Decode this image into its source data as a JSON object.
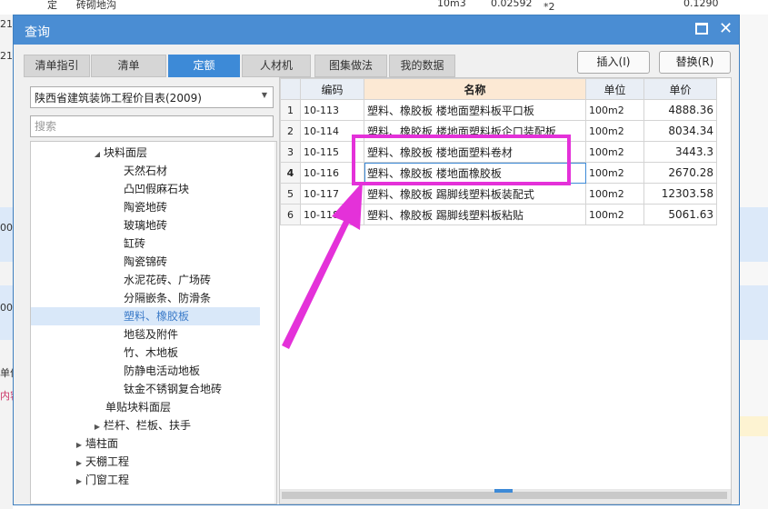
{
  "background": {
    "top_cells": [
      "定",
      "砖砌地沟",
      "10m3",
      "0.02592",
      "*2",
      "0.1290"
    ],
    "left_fragments": [
      "21",
      "21",
      "00",
      "00",
      "单价",
      "内容"
    ]
  },
  "dialog": {
    "title": "查询",
    "tabs": [
      {
        "label": "清单指引"
      },
      {
        "label": "清单"
      },
      {
        "label": "定额"
      },
      {
        "label": "人材机"
      },
      {
        "label": "图集做法"
      },
      {
        "label": "我的数据"
      }
    ],
    "active_tab": "定额",
    "buttons": {
      "insert": "插入(I)",
      "replace": "替换(R)"
    }
  },
  "left_panel": {
    "dropdown_value": "陕西省建筑装饰工程价目表(2009)",
    "search_placeholder": "搜索",
    "tree": [
      {
        "label": "块料面层",
        "toggle": "◢"
      },
      {
        "label": "天然石材",
        "toggle": ""
      },
      {
        "label": "凸凹假麻石块",
        "toggle": ""
      },
      {
        "label": "陶瓷地砖",
        "toggle": ""
      },
      {
        "label": "玻璃地砖",
        "toggle": ""
      },
      {
        "label": "缸砖",
        "toggle": ""
      },
      {
        "label": "陶瓷锦砖",
        "toggle": ""
      },
      {
        "label": "水泥花砖、广场砖",
        "toggle": ""
      },
      {
        "label": "分隔嵌条、防滑条",
        "toggle": ""
      },
      {
        "label": "塑料、橡胶板",
        "toggle": ""
      },
      {
        "label": "地毯及附件",
        "toggle": ""
      },
      {
        "label": "竹、木地板",
        "toggle": ""
      },
      {
        "label": "防静电活动地板",
        "toggle": ""
      },
      {
        "label": "钛金不锈钢复合地砖",
        "toggle": ""
      },
      {
        "label": "单贴块料面层",
        "toggle": ""
      },
      {
        "label": "栏杆、栏板、扶手",
        "toggle": "▶"
      },
      {
        "label": "墙柱面",
        "toggle": "▶"
      },
      {
        "label": "天棚工程",
        "toggle": "▶"
      },
      {
        "label": "门窗工程",
        "toggle": "▶"
      }
    ]
  },
  "table": {
    "headers": [
      "编码",
      "名称",
      "单位",
      "单价"
    ],
    "rows": [
      {
        "num": "1",
        "code": "10-113",
        "name": "塑料、橡胶板 楼地面塑料板平口板",
        "unit": "100m2",
        "price": "4888.36"
      },
      {
        "num": "2",
        "code": "10-114",
        "name": "塑料、橡胶板 楼地面塑料板企口装配板",
        "unit": "100m2",
        "price": "8034.34"
      },
      {
        "num": "3",
        "code": "10-115",
        "name": "塑料、橡胶板 楼地面塑料卷材",
        "unit": "100m2",
        "price": "3443.3"
      },
      {
        "num": "4",
        "code": "10-116",
        "name": "塑料、橡胶板 楼地面橡胶板",
        "unit": "100m2",
        "price": "2670.28"
      },
      {
        "num": "5",
        "code": "10-117",
        "name": "塑料、橡胶板 踢脚线塑料板装配式",
        "unit": "100m2",
        "price": "12303.58"
      },
      {
        "num": "6",
        "code": "10-118",
        "name": "塑料、橡胶板 踢脚线塑料板粘贴",
        "unit": "100m2",
        "price": "5061.63"
      }
    ]
  },
  "colors": {
    "titlebar": "#4a8dd3",
    "active_tab": "#3d8ad7",
    "highlight": "#e431d9"
  }
}
